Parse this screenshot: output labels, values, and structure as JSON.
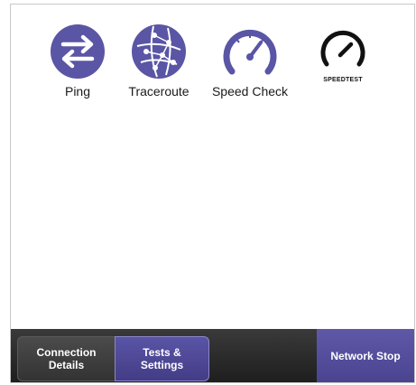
{
  "colors": {
    "icon_purple": "#5a55a5",
    "active_tab": "#4f4898",
    "network_stop": "#5a53a3",
    "bar_dark": "#2c2c2c"
  },
  "apps": [
    {
      "label": "Ping",
      "icon": "ping-arrows-icon"
    },
    {
      "label": "Traceroute",
      "icon": "traceroute-globe-icon"
    },
    {
      "label": "Speed Check",
      "icon": "speedometer-icon"
    },
    {
      "label": "SPEEDTEST",
      "icon": "speedtest-gauge-icon"
    }
  ],
  "bottom_bar": {
    "tabs": [
      {
        "label_line1": "Connection",
        "label_line2": "Details",
        "selected": false
      },
      {
        "label_line1": "Tests &",
        "label_line2": "Settings",
        "selected": true
      }
    ],
    "network_stop_label": "Network Stop"
  }
}
